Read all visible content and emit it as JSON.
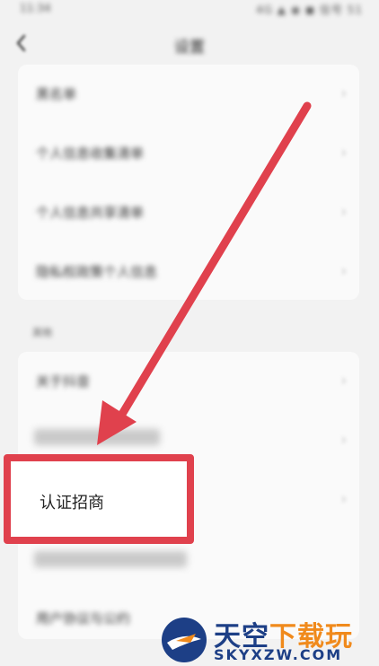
{
  "status_bar": {
    "time": "11:34",
    "indicators": "4G ▲ ◉ ◼ 信号 51"
  },
  "header": {
    "title": "设置"
  },
  "group1": {
    "items": [
      {
        "label": "黑名单"
      },
      {
        "label": "个人信息收集清单"
      },
      {
        "label": "个人信息共享清单"
      },
      {
        "label": "隐私权政策个人信息"
      }
    ]
  },
  "section2": {
    "label": "其他"
  },
  "group2": {
    "items": [
      {
        "label": "关于抖音"
      }
    ]
  },
  "highlight": {
    "label": "认证招商",
    "color": "#e0414d"
  },
  "group2_bottom": {
    "label": "用户协议与公约"
  },
  "watermark": {
    "title_main": "天空",
    "title_accent": "下载玩",
    "domain": "SKYXZW.COM"
  },
  "colors": {
    "accent": "#e0414d",
    "brand_blue": "#1d3f86",
    "brand_orange": "#f08a1c"
  }
}
